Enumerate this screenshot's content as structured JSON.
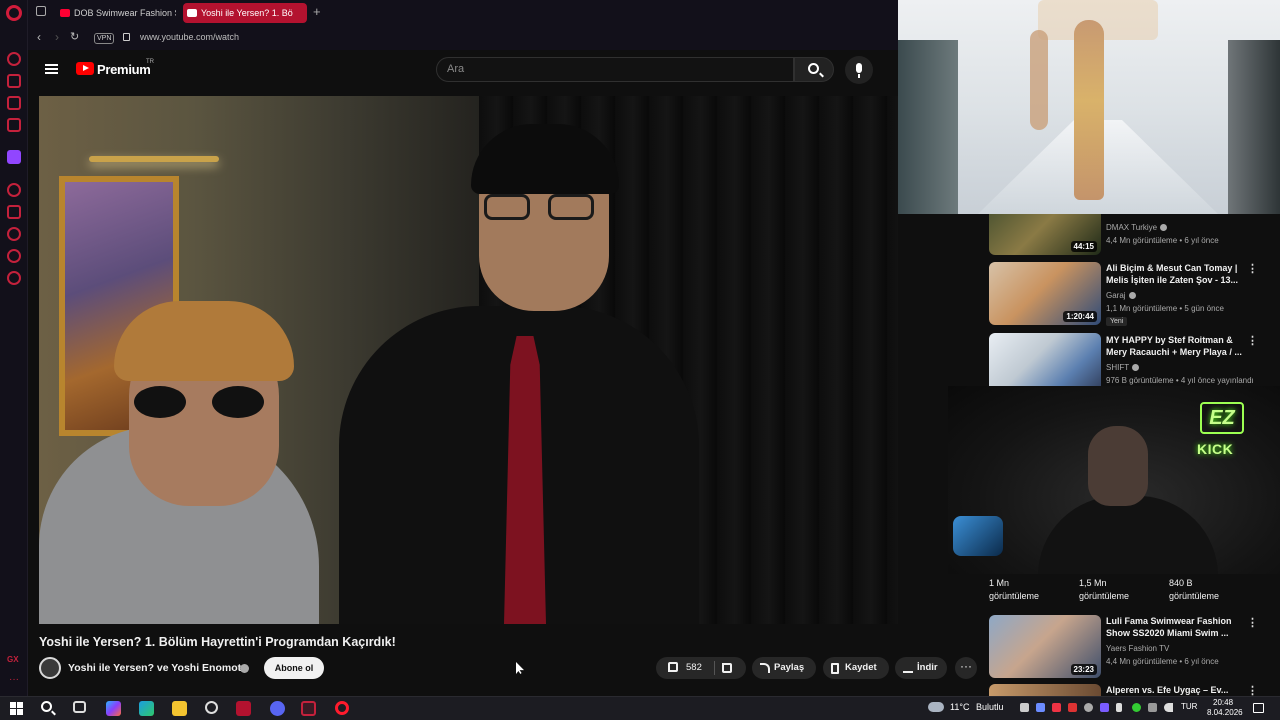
{
  "browser": {
    "tabs": [
      {
        "label": "DOB Swimwear Fashion Sh",
        "active": false
      },
      {
        "label": "Yoshi ile Yersen? 1. Bö",
        "active": true
      }
    ],
    "new_tab": "+",
    "vpn": "VPN",
    "url": "www.youtube.com/watch",
    "sidebar_gx": "GX",
    "sidebar_more": "···"
  },
  "youtube": {
    "logo_label": "Premium",
    "logo_tr": "TR",
    "search_placeholder": "Ara",
    "video": {
      "title": "Yoshi ile Yersen? 1. Bölüm Hayrettin'i Programdan Kaçırdık!",
      "channel": "Yoshi ile Yersen? ve Yoshi Enomoto",
      "subscribe": "Abone ol",
      "likes": "582",
      "share": "Paylaş",
      "save": "Kaydet",
      "download": "İndir",
      "more": "···"
    },
    "recommendations": [
      {
        "title": "",
        "channel": "DMAX Turkiye",
        "meta": "4,4 Mn görüntüleme • 6 yıl önce",
        "duration": "44:15",
        "badge": ""
      },
      {
        "title": "Ali Biçim & Mesut Can Tomay | Melis İşiten ile Zaten Şov - 13...",
        "channel": "Garaj",
        "meta": "1,1 Mn görüntüleme • 5 gün önce",
        "duration": "1:20:44",
        "badge": "Yeni"
      },
      {
        "title": "MY HAPPY by Stef Roitman & Mery Racauchi + Mery Playa / ...",
        "channel": "SHIFT",
        "meta": "976 B görüntüleme • 4 yıl önce yayınlandı",
        "duration": "",
        "badge": ""
      }
    ],
    "shorts_views": [
      {
        "count": "1 Mn",
        "label": "görüntüleme"
      },
      {
        "count": "1,5 Mn",
        "label": "görüntüleme"
      },
      {
        "count": "840 B",
        "label": "görüntüleme"
      }
    ],
    "recommendations_lower": [
      {
        "title": "Luli Fama Swimwear Fashion Show SS2020 Miami Swim ...",
        "channel": "Yaers Fashion TV",
        "meta": "4,4 Mn görüntüleme • 6 yıl önce",
        "duration": "23:23"
      },
      {
        "title": "Alperen vs. Efe Uygaç – Ev...",
        "channel": "",
        "meta": "",
        "duration": ""
      }
    ]
  },
  "stream_overlay": {
    "logo": "EZ",
    "kick": "KICK"
  },
  "taskbar": {
    "weather_temp": "11°C",
    "weather_desc": "Bulutlu",
    "language": "TUR",
    "time": "20:48",
    "date": "8.04.2026"
  },
  "colors": {
    "accent_red": "#ff0033",
    "opera_red": "#c4213c",
    "kick_green": "#53fc18",
    "yt_bg": "#0f0f0f"
  }
}
